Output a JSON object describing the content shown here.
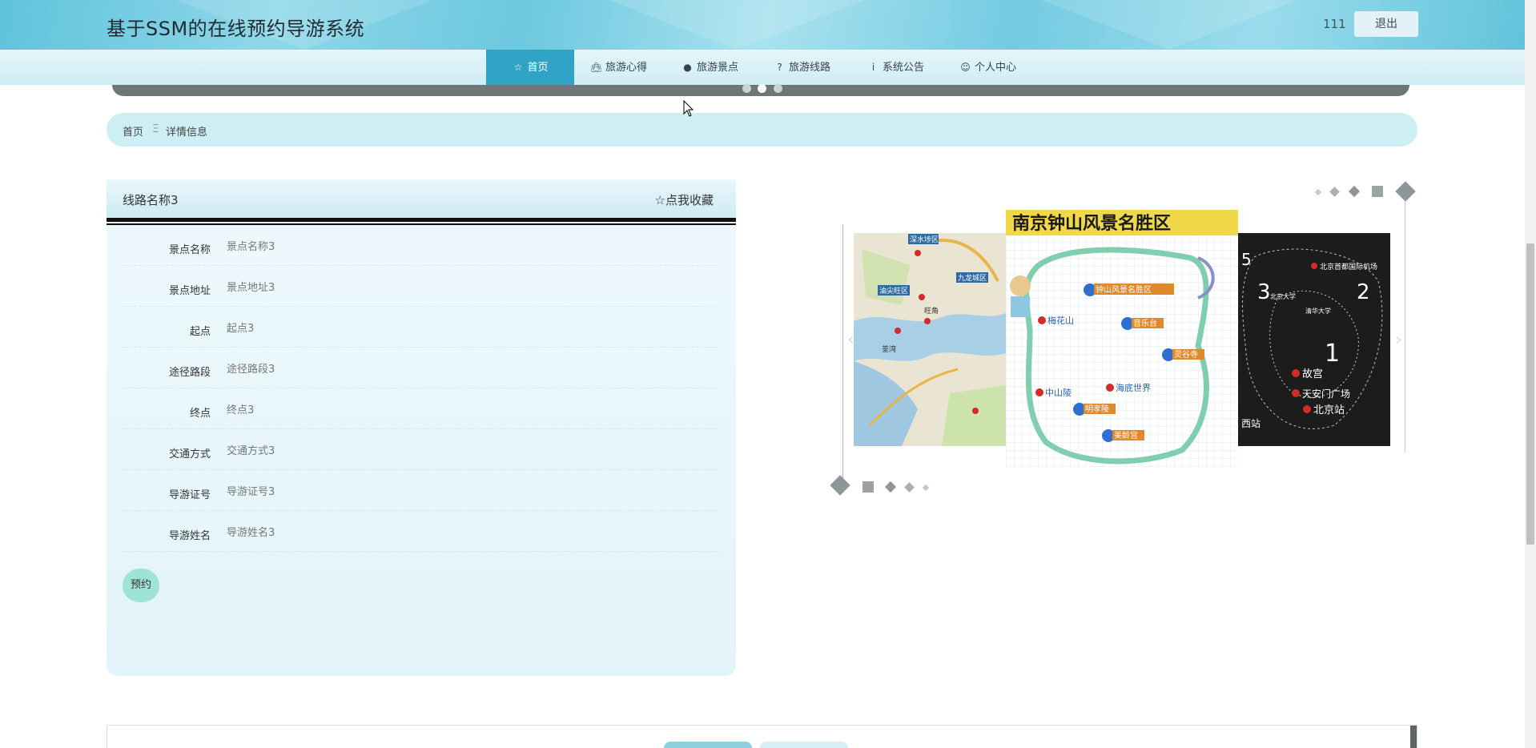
{
  "header": {
    "site_title": "基于SSM的在线预约导游系统",
    "username": "111",
    "logout_label": "退出"
  },
  "nav": {
    "items": [
      {
        "label": "首页",
        "icon": "star-icon",
        "active": true
      },
      {
        "label": "旅游心得",
        "icon": "bag-icon",
        "active": false
      },
      {
        "label": "旅游景点",
        "icon": "alert-icon",
        "active": false
      },
      {
        "label": "旅游线路",
        "icon": "question-icon",
        "active": false
      },
      {
        "label": "系统公告",
        "icon": "info-icon",
        "active": false
      },
      {
        "label": "个人中心",
        "icon": "user-icon",
        "active": false
      }
    ]
  },
  "breadcrumb": {
    "home": "首页",
    "separator": "Ξ",
    "current": "详情信息"
  },
  "detail": {
    "title": "线路名称3",
    "favorite_label": "☆点我收藏",
    "rows": [
      {
        "label": "景点名称",
        "value": "景点名称3"
      },
      {
        "label": "景点地址",
        "value": "景点地址3"
      },
      {
        "label": "起点",
        "value": "起点3"
      },
      {
        "label": "途径路段",
        "value": "途径路段3"
      },
      {
        "label": "终点",
        "value": "终点3"
      },
      {
        "label": "交通方式",
        "value": "交通方式3"
      },
      {
        "label": "导游证号",
        "value": "导游证号3"
      },
      {
        "label": "导游姓名",
        "value": "导游姓名3"
      }
    ],
    "book_label": "预约"
  },
  "carousel": {
    "center_image_title": "南京钟山风景名胜区",
    "center_labels": [
      "钟山风景名胜区",
      "音乐台",
      "灵谷寺",
      "明孝陵",
      "美龄宫",
      "海底世界",
      "梅花山",
      "中山陵"
    ],
    "left_labels": [
      "深水埗区",
      "九龙城区",
      "油尖旺区",
      "旺角",
      "荃湾"
    ],
    "right_labels": [
      "北京首都国际机场",
      "故宫",
      "天安门广场",
      "北京站",
      "西站",
      "北京大学",
      "清华大学",
      "1",
      "2",
      "3",
      "5"
    ]
  },
  "colors": {
    "nav_active": "#2fa4c7",
    "breadcrumb_bg": "#cdeef4",
    "book_button": "#9ee3d5"
  }
}
